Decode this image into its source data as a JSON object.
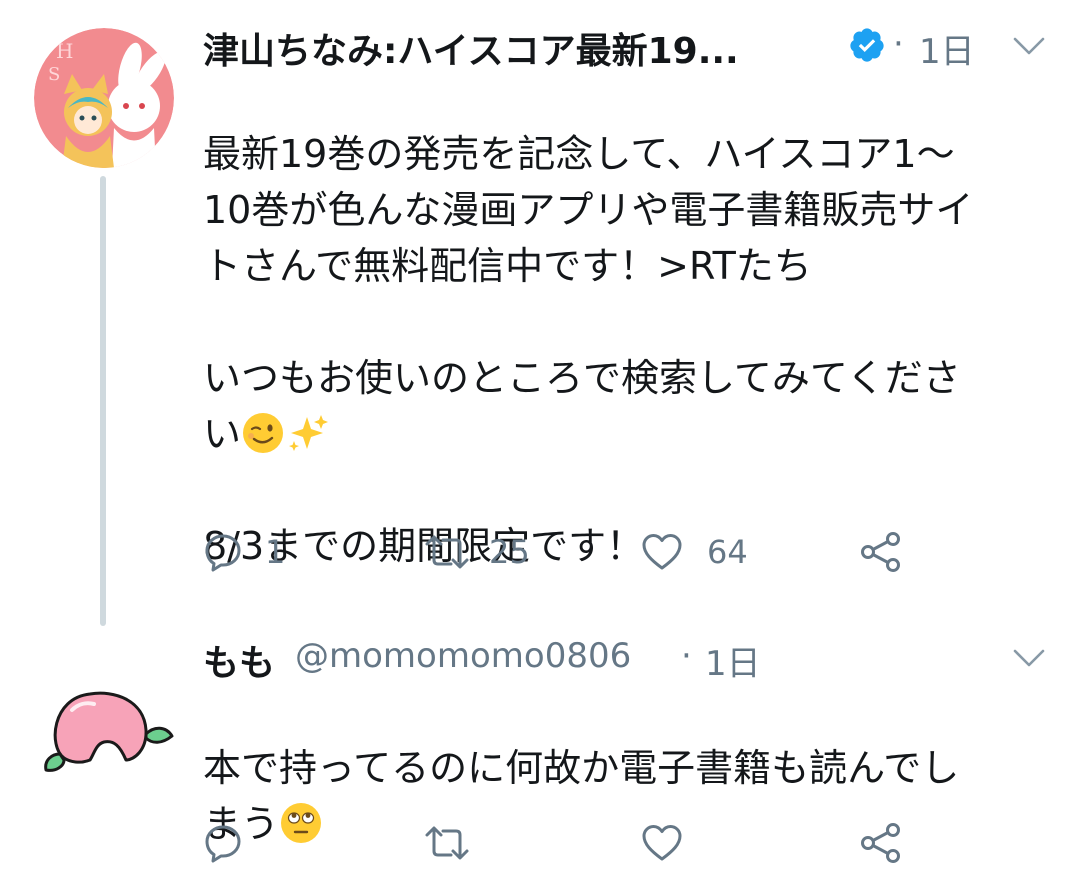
{
  "tweets": [
    {
      "display_name": "津山ちなみ:ハイスコア最新19...",
      "verified": true,
      "separator": "·",
      "time": "1日",
      "text_lines": [
        "最新19巻の発売を記念して、ハイスコア1〜",
        "10巻が色んな漫画アプリや電子書籍販売サイ",
        "トさんで無料配信中です！>RTたち",
        "",
        "いつもお使いのところで検索してみてくださ",
        "い",
        "",
        "8/3までの期間限定です！"
      ],
      "emojis": [
        "winking-face-emoji",
        "sparkles-emoji"
      ],
      "actions": {
        "reply_count": "1",
        "retweet_count": "25",
        "like_count": "64"
      }
    },
    {
      "display_name": "もも",
      "handle": "@momomomo0806",
      "separator": "·",
      "time": "1日",
      "text_lines": [
        "本で持ってるのに何故か電子書籍も読んでし",
        "まう"
      ],
      "emojis": [
        "face-with-rolling-eyes-emoji"
      ],
      "actions": {
        "reply_count": "",
        "retweet_count": "",
        "like_count": ""
      }
    }
  ],
  "colors": {
    "text": "#14171a",
    "secondary": "#657786",
    "verified": "#1da1f2",
    "thread_line": "#cfd9de"
  }
}
